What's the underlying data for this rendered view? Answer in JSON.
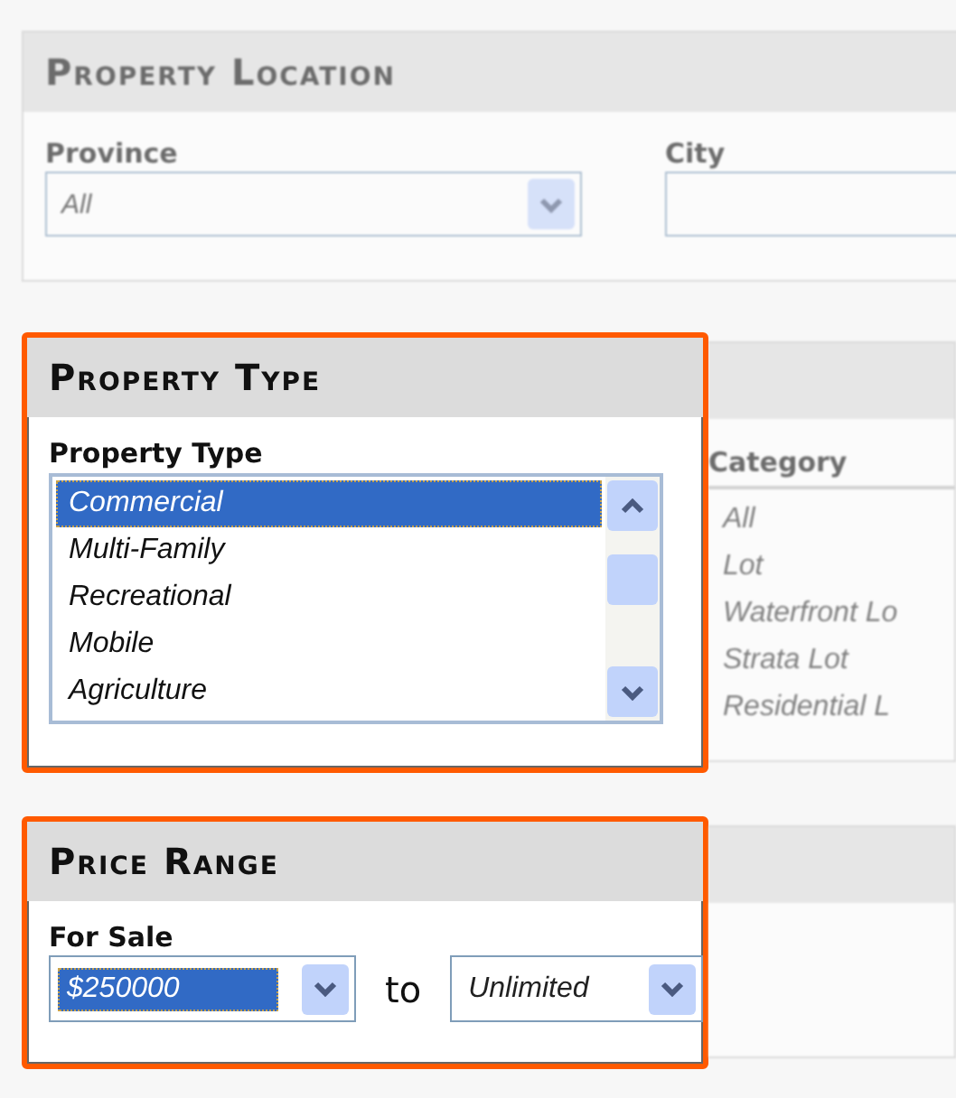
{
  "location": {
    "title": "Property Location",
    "faded": true,
    "province": {
      "label": "Province",
      "value": "All"
    },
    "city": {
      "label": "City"
    }
  },
  "property_type": {
    "title": "Property Type",
    "highlighted": true,
    "list": {
      "label": "Property Type",
      "items": [
        {
          "label": "Commercial",
          "selected": true
        },
        {
          "label": "Multi-Family",
          "selected": false
        },
        {
          "label": "Recreational",
          "selected": false
        },
        {
          "label": "Mobile",
          "selected": false
        },
        {
          "label": "Agriculture",
          "selected": false
        }
      ]
    }
  },
  "category": {
    "faded": true,
    "label": "Category",
    "items": [
      "All",
      "Lot",
      "Waterfront Lo",
      "Strata Lot",
      "Residential L"
    ]
  },
  "price_range": {
    "title": "Price Range",
    "highlighted": true,
    "for_sale": {
      "label": "For Sale",
      "from": {
        "value": "$250000",
        "focused": true
      },
      "separator": "to",
      "to": {
        "value": "Unlimited",
        "focused": false
      }
    }
  }
}
